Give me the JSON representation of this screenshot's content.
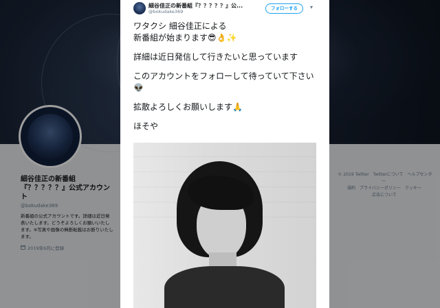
{
  "profile": {
    "name": "細谷佳正の新番組\n『？？？？？』公式アカウント",
    "handle": "@bokudake369",
    "bio": "新番組の公式アカウントです。詳細は近日発表いたします。どうぞよろしくお願いいたします。※写真や画像の無断転載はお断りいたします。",
    "joined": "2019年6月に登録"
  },
  "footer": {
    "links": [
      "© 2019 Twitter",
      "Twitterについて",
      "ヘルプセンター",
      "規約",
      "プライバシーポリシー",
      "クッキー",
      "広告について"
    ]
  },
  "tweet": {
    "display_name": "細谷佳正の新番組『？？？？？』公...",
    "handle": "@bokudake369",
    "follow_label": "フォローする",
    "lines": [
      "ワタクシ 細谷佳正による\n新番組が始まります😎👌✨",
      "詳細は近日発信して行きたいと思っています",
      "このアカウントをフォローして待っていて下さい👽",
      "拡散よろしくお願いします🙏",
      "ほそや"
    ]
  },
  "icons": {
    "chevron": "chevron-down-icon",
    "calendar": "calendar-icon"
  },
  "colors": {
    "accent": "#1da1f2",
    "text": "#14171a",
    "muted": "#657786"
  }
}
